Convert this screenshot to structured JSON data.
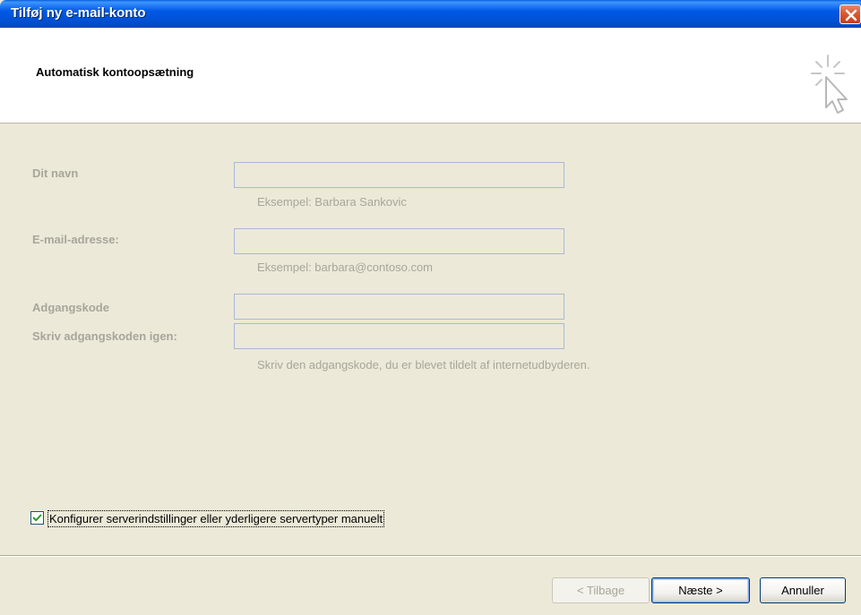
{
  "window": {
    "title": "Tilføj ny e-mail-konto"
  },
  "header": {
    "subtitle": "Automatisk kontoopsætning"
  },
  "form": {
    "name": {
      "label": "Dit navn",
      "value": "",
      "hint": "Eksempel: Barbara Sankovic"
    },
    "email": {
      "label": "E-mail-adresse:",
      "value": "",
      "hint": "Eksempel: barbara@contoso.com"
    },
    "password": {
      "label": "Adgangskode",
      "value": ""
    },
    "password_repeat": {
      "label": "Skriv adgangskoden igen:",
      "value": "",
      "hint": "Skriv den adgangskode, du er blevet tildelt af internetudbyderen."
    }
  },
  "manual_config": {
    "label": "Konfigurer serverindstillinger eller yderligere servertyper manuelt",
    "checked": true
  },
  "buttons": {
    "back": "< Tilbage",
    "next": "Næste >",
    "cancel": "Annuller"
  },
  "icons": {
    "close": "close-icon",
    "wizard": "sparkle-cursor-icon",
    "check": "checkmark-icon"
  },
  "colors": {
    "titlebar": "#0054e3",
    "dialog_bg": "#ece9d8",
    "disabled_text": "#a7a69a"
  }
}
